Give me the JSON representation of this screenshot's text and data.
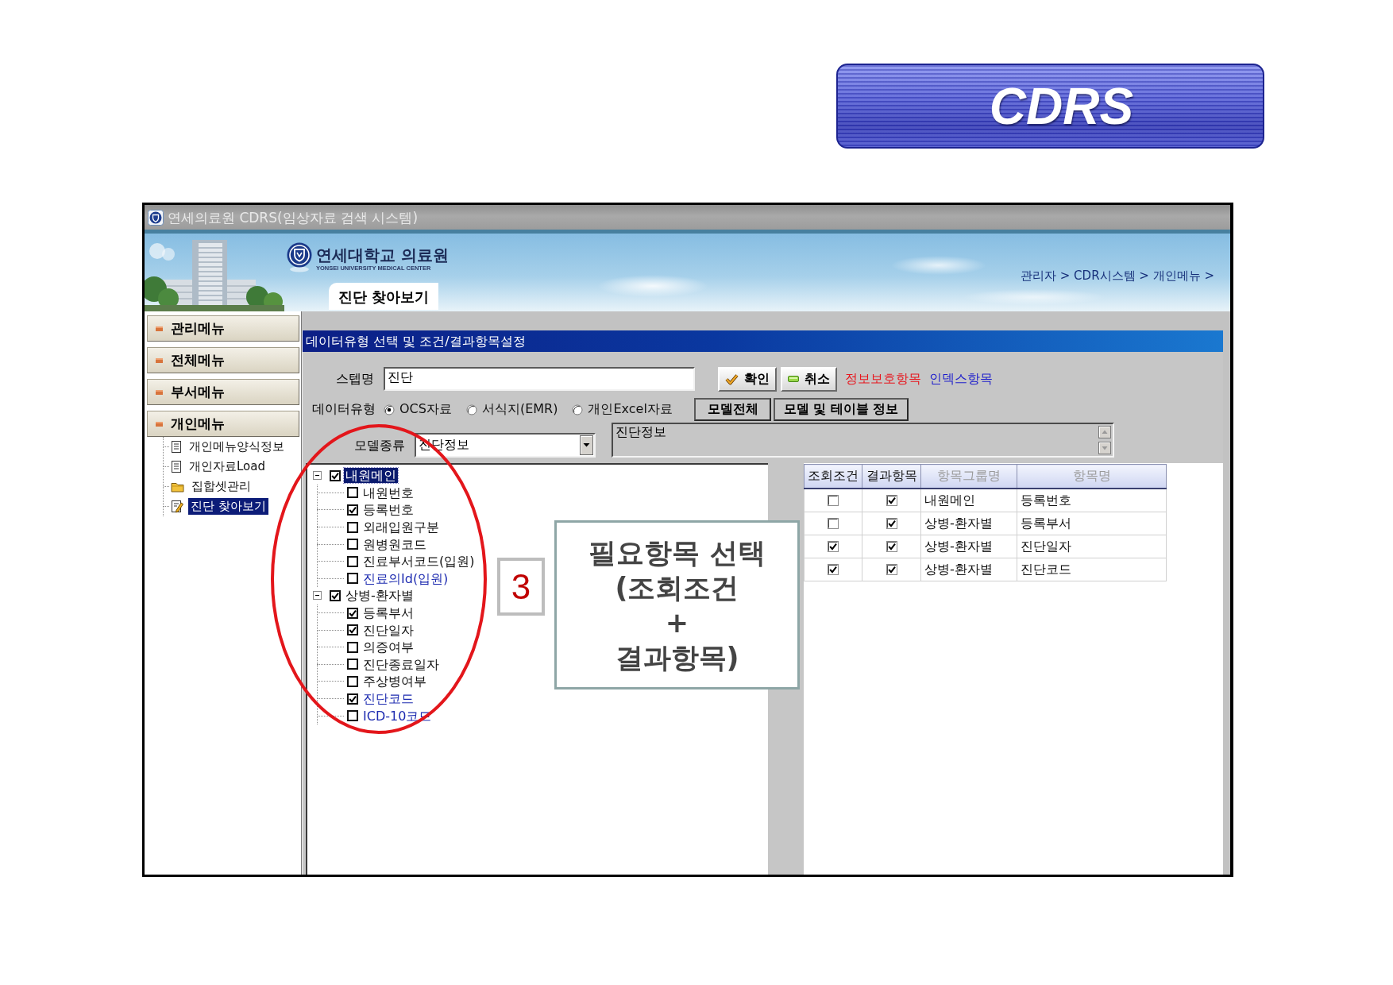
{
  "slide": {
    "title": "CDRS"
  },
  "window": {
    "title": "연세의료원 CDRS(임상자료 검색 시스템)"
  },
  "header": {
    "logo_text": "연세대학교 의료원",
    "logo_subtitle": "YONSEI UNIVERSITY MEDICAL CENTER",
    "page_title": "진단 찾아보기",
    "breadcrumb": "관리자 > CDR시스템 > 개인메뉴 >"
  },
  "sidebar": {
    "menus": [
      {
        "label": "관리메뉴"
      },
      {
        "label": "전체메뉴"
      },
      {
        "label": "부서메뉴"
      },
      {
        "label": "개인메뉴",
        "items": [
          {
            "label": "개인메뉴양식정보",
            "kind": "document",
            "selected": false
          },
          {
            "label": "개인자료Load",
            "kind": "document",
            "selected": false
          },
          {
            "label": "집합셋관리",
            "kind": "folder",
            "selected": false
          },
          {
            "label": "진단 찾아보기",
            "kind": "query",
            "selected": true
          }
        ]
      }
    ]
  },
  "dialog": {
    "title": "데이터유형 선택 및 조건/결과항목설정",
    "step_name": {
      "label": "스텝명",
      "value": "진단"
    },
    "buttons": [
      {
        "label": "확인",
        "kind": "confirm"
      },
      {
        "label": "취소",
        "kind": "cancel"
      }
    ],
    "legend": [
      {
        "label": "정보보호항목",
        "color": "#e8141c"
      },
      {
        "label": "인덱스항목",
        "color": "#1a1acc"
      }
    ],
    "data_type": {
      "label": "데이터유형",
      "options": [
        {
          "label": "OCS자료",
          "selected": true
        },
        {
          "label": "서식지(EMR)",
          "selected": false
        },
        {
          "label": "개인Excel자료",
          "selected": false
        }
      ]
    },
    "model_buttons": [
      "모델전체",
      "모델 및 테이블 정보"
    ],
    "model_kind": {
      "label": "모델종류",
      "value": "진단정보"
    },
    "model_description": {
      "value": "진단정보"
    },
    "tree": [
      {
        "label": "내원메인",
        "checked": true,
        "selected": true,
        "index": false,
        "expanded": true,
        "children": [
          {
            "label": "내원번호",
            "checked": false,
            "selected": false,
            "index": false
          },
          {
            "label": "등록번호",
            "checked": true,
            "selected": false,
            "index": false
          },
          {
            "label": "외래입원구분",
            "checked": false,
            "selected": false,
            "index": false
          },
          {
            "label": "원병원코드",
            "checked": false,
            "selected": false,
            "index": false
          },
          {
            "label": "진료부서코드(입원)",
            "checked": false,
            "selected": false,
            "index": false
          },
          {
            "label": "진료의Id(입원)",
            "checked": false,
            "selected": false,
            "index": true
          }
        ]
      },
      {
        "label": "상병-환자별",
        "checked": true,
        "selected": false,
        "index": false,
        "expanded": true,
        "children": [
          {
            "label": "등록부서",
            "checked": true,
            "selected": false,
            "index": false
          },
          {
            "label": "진단일자",
            "checked": true,
            "selected": false,
            "index": false
          },
          {
            "label": "의증여부",
            "checked": false,
            "selected": false,
            "index": false
          },
          {
            "label": "진단종료일자",
            "checked": false,
            "selected": false,
            "index": false
          },
          {
            "label": "주상병여부",
            "checked": false,
            "selected": false,
            "index": false
          },
          {
            "label": "진단코드",
            "checked": true,
            "selected": false,
            "index": true
          },
          {
            "label": "ICD-10코드",
            "checked": false,
            "selected": false,
            "index": true
          }
        ]
      }
    ],
    "table": {
      "columns": [
        {
          "label": "조회조건",
          "disabled": false
        },
        {
          "label": "결과항목",
          "disabled": false
        },
        {
          "label": "항목그룹명",
          "disabled": true
        },
        {
          "label": "항목명",
          "disabled": true
        }
      ],
      "rows": [
        {
          "query": false,
          "result": true,
          "group": "내원메인",
          "item": "등록번호"
        },
        {
          "query": false,
          "result": true,
          "group": "상병-환자별",
          "item": "등록부서"
        },
        {
          "query": true,
          "result": true,
          "group": "상병-환자별",
          "item": "진단일자"
        },
        {
          "query": true,
          "result": true,
          "group": "상병-환자별",
          "item": "진단코드"
        }
      ]
    }
  },
  "annotation": {
    "step": "3",
    "callout": "필요항목 선택\n(조회조건\n+\n결과항목)"
  }
}
